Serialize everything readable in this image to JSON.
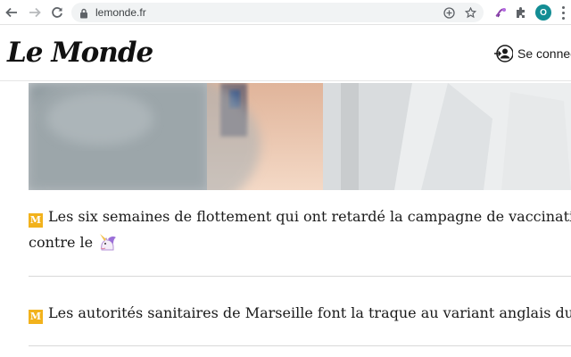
{
  "browser": {
    "url": "lemonde.fr",
    "profile_initial": "O",
    "icons": [
      "back-arrow-icon",
      "forward-arrow-icon",
      "reload-icon",
      "lock-icon",
      "add-icon",
      "star-icon",
      "extension-icon",
      "puzzle-icon",
      "menu-icon"
    ]
  },
  "site": {
    "logo": "Le Monde",
    "login_label": "Se connecter"
  },
  "articles": [
    {
      "badge": "M",
      "line1": "Les six semaines de flottement qui ont retardé la campagne de vaccination",
      "line2": "contre le",
      "emoji": "unicorn-emoji"
    },
    {
      "badge": "M",
      "line1": "Les autorités sanitaires de Marseille font la traque au variant anglais du",
      "emoji": "unicorn-emoji"
    }
  ],
  "colors": {
    "badge": "#f2b21c",
    "profile": "#138d94",
    "omnibox": "#f1f3f4"
  }
}
